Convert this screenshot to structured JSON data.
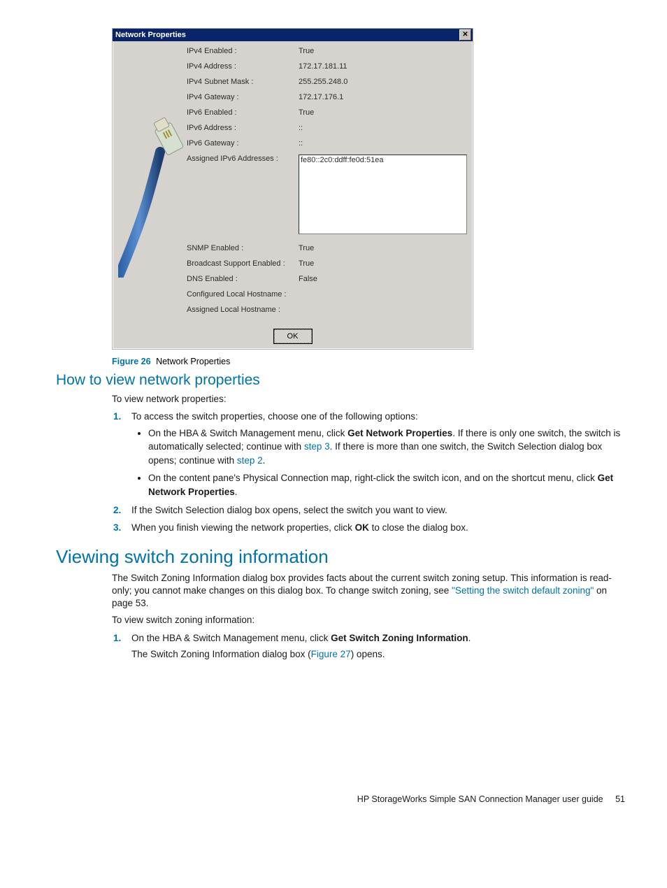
{
  "dialog": {
    "title": "Network Properties",
    "close_glyph": "✕",
    "rows": [
      {
        "label": "IPv4 Enabled :",
        "value": "True"
      },
      {
        "label": "IPv4 Address :",
        "value": "172.17.181.11"
      },
      {
        "label": "IPv4 Subnet Mask :",
        "value": "255.255.248.0"
      },
      {
        "label": "IPv4 Gateway :",
        "value": "172.17.176.1"
      },
      {
        "label": "IPv6 Enabled :",
        "value": "True"
      },
      {
        "label": "IPv6 Address :",
        "value": "::"
      },
      {
        "label": "IPv6 Gateway :",
        "value": "::"
      }
    ],
    "assigned_ipv6_label": "Assigned IPv6 Addresses :",
    "assigned_ipv6_value": "fe80::2c0:ddff:fe0d:51ea",
    "rows2": [
      {
        "label": "SNMP Enabled :",
        "value": "True"
      },
      {
        "label": "Broadcast Support Enabled :",
        "value": "True"
      },
      {
        "label": "DNS Enabled :",
        "value": "False"
      },
      {
        "label": "Configured Local Hostname :",
        "value": ""
      },
      {
        "label": "Assigned Local Hostname :",
        "value": ""
      }
    ],
    "ok_label": "OK"
  },
  "figure": {
    "label": "Figure 26",
    "caption": "Network Properties"
  },
  "section1": {
    "heading": "How to view network properties",
    "intro": "To view network properties:",
    "step1_intro": "To access the switch properties, choose one of the following options:",
    "b1_pre": "On the HBA & Switch Management menu, click ",
    "b1_bold": "Get Network Properties",
    "b1_post": ". If there is only one switch, the switch is automatically selected; continue with ",
    "b1_link1": "step 3",
    "b1_post2": ". If there is more than one switch, the Switch Selection dialog box opens; continue with ",
    "b1_link2": "step 2",
    "b1_post3": ".",
    "b2_pre": "On the content pane's Physical Connection map, right-click the switch icon, and on the shortcut menu, click ",
    "b2_bold": "Get Network Properties",
    "b2_post": ".",
    "step2": "If the Switch Selection dialog box opens, select the switch you want to view.",
    "step3_pre": "When you finish viewing the network properties, click ",
    "step3_bold": "OK",
    "step3_post": " to close the dialog box."
  },
  "section2": {
    "heading": "Viewing switch zoning information",
    "p1_pre": "The Switch Zoning Information dialog box provides facts about the current switch zoning setup. This information is read-only; you cannot make changes on this dialog box. To change switch zoning, see ",
    "p1_link": "\"Setting the switch default zoning\"",
    "p1_post": " on page 53.",
    "p2": "To view switch zoning information:",
    "step1_pre": "On the HBA & Switch Management menu, click ",
    "step1_bold": "Get Switch Zoning Information",
    "step1_post": ".",
    "step1_line2_pre": "The Switch Zoning Information dialog box (",
    "step1_line2_link": "Figure 27",
    "step1_line2_post": ") opens."
  },
  "footer": {
    "text": "HP StorageWorks Simple SAN Connection Manager user guide",
    "page": "51"
  }
}
